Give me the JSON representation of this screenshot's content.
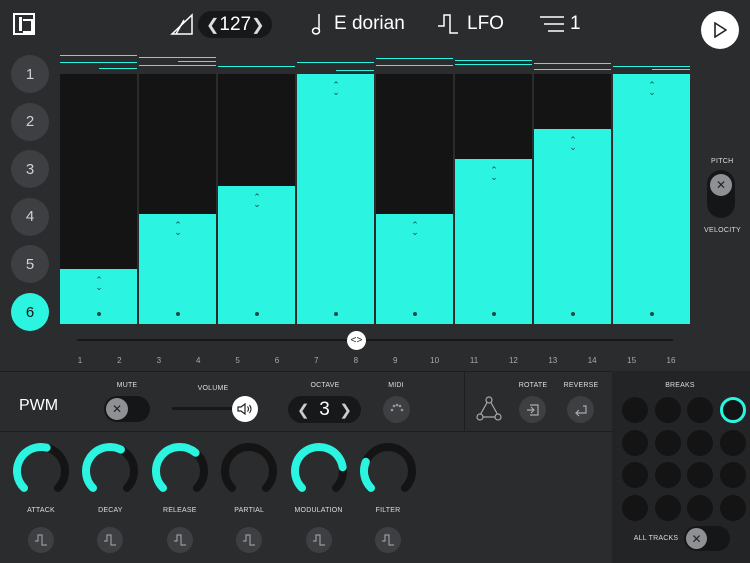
{
  "topbar": {
    "tempo_value": "127",
    "scale_label": "E dorian",
    "lfo_label": "LFO",
    "pattern_value": "1"
  },
  "tracks": [
    "1",
    "2",
    "3",
    "4",
    "5",
    "6"
  ],
  "active_track": 5,
  "sequencer": {
    "step_numbers": [
      "1",
      "2",
      "3",
      "4",
      "5",
      "6",
      "7",
      "8",
      "9",
      "10",
      "11",
      "12",
      "13",
      "14",
      "15",
      "16"
    ],
    "column_levels": [
      0.22,
      0.44,
      0.55,
      1.0,
      0.44,
      0.66,
      0.78,
      1.0
    ],
    "accent_color": "#2bf5e0"
  },
  "pitch_label": "PITCH",
  "velocity_label": "VELOCITY",
  "track_panel": {
    "name": "PWM",
    "mute_label": "MUTE",
    "volume_label": "VOLUME",
    "octave_label": "OCTAVE",
    "octave_value": "3",
    "midi_label": "MIDI",
    "rotate_label": "ROTATE",
    "reverse_label": "REVERSE",
    "breaks_label": "BREAKS",
    "all_tracks_label": "ALL TRACKS"
  },
  "knobs": [
    {
      "label": "ATTACK",
      "level": 0.55
    },
    {
      "label": "DECAY",
      "level": 0.6
    },
    {
      "label": "RELEASE",
      "level": 0.65
    },
    {
      "label": "PARTIAL",
      "level": 0.0
    },
    {
      "label": "MODULATION",
      "level": 0.8
    },
    {
      "label": "FILTER",
      "level": 0.25
    }
  ],
  "breaks_active_index": 3
}
